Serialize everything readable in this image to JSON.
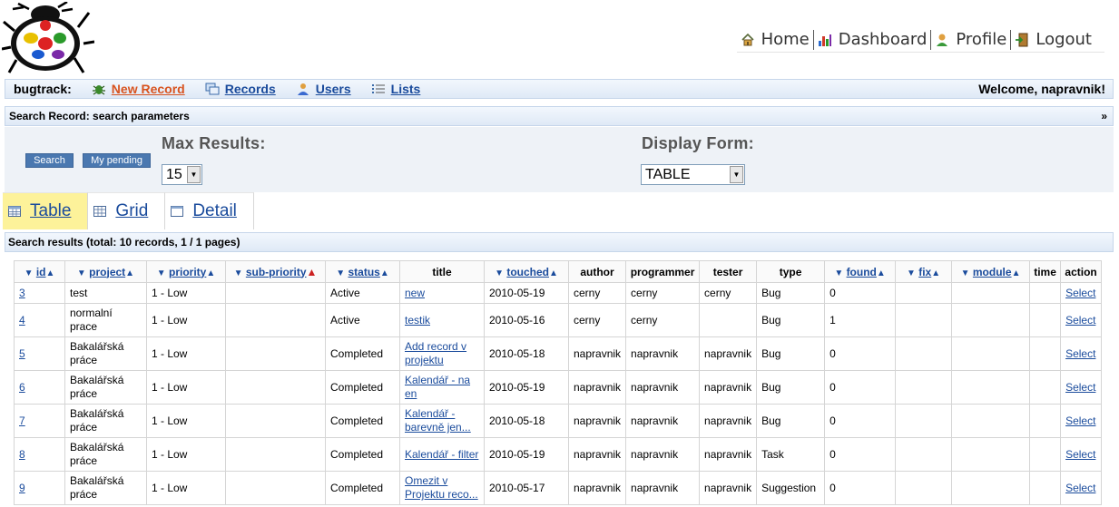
{
  "nav": {
    "home": "Home",
    "dashboard": "Dashboard",
    "profile": "Profile",
    "logout": "Logout"
  },
  "menu": {
    "brand": "bugtrack:",
    "new_record": "New Record",
    "records": "Records",
    "users": "Users",
    "lists": "Lists",
    "welcome": "Welcome, napravnik!"
  },
  "search_panel": {
    "title": "Search Record: search parameters",
    "toggle": "»",
    "search_button": "Search",
    "pending_button": "My pending",
    "max_results_label": "Max Results:",
    "max_results_value": "15",
    "display_form_label": "Display Form:",
    "display_form_value": "TABLE"
  },
  "tabs": {
    "table": "Table",
    "grid": "Grid",
    "detail": "Detail"
  },
  "results": {
    "title": "Search results (total: 10 records, 1 / 1 pages)",
    "columns": [
      "id",
      "project",
      "priority",
      "sub-priority",
      "status",
      "title",
      "touched",
      "author",
      "programmer",
      "tester",
      "type",
      "found",
      "fix",
      "module",
      "time",
      "action"
    ],
    "rows": [
      {
        "id": "3",
        "project": "test",
        "priority": "1 - Low",
        "sub": "",
        "status": "Active",
        "title": "new",
        "touched": "2010-05-19",
        "author": "cerny",
        "programmer": "cerny",
        "tester": "cerny",
        "type": "Bug",
        "found": "0",
        "fix": "",
        "module": "",
        "time": "",
        "action": "Select"
      },
      {
        "id": "4",
        "project": "normalní prace",
        "priority": "1 - Low",
        "sub": "",
        "status": "Active",
        "title": "testik",
        "touched": "2010-05-16",
        "author": "cerny",
        "programmer": "cerny",
        "tester": "",
        "type": "Bug",
        "found": "1",
        "fix": "",
        "module": "",
        "time": "",
        "action": "Select"
      },
      {
        "id": "5",
        "project": "Bakalářská práce",
        "priority": "1 - Low",
        "sub": "",
        "status": "Completed",
        "title": "Add record v projektu",
        "touched": "2010-05-18",
        "author": "napravnik",
        "programmer": "napravnik",
        "tester": "napravnik",
        "type": "Bug",
        "found": "0",
        "fix": "",
        "module": "",
        "time": "",
        "action": "Select"
      },
      {
        "id": "6",
        "project": "Bakalářská práce",
        "priority": "1 - Low",
        "sub": "",
        "status": "Completed",
        "title": "Kalendář - na en",
        "touched": "2010-05-19",
        "author": "napravnik",
        "programmer": "napravnik",
        "tester": "napravnik",
        "type": "Bug",
        "found": "0",
        "fix": "",
        "module": "",
        "time": "",
        "action": "Select"
      },
      {
        "id": "7",
        "project": "Bakalářská práce",
        "priority": "1 - Low",
        "sub": "",
        "status": "Completed",
        "title": "Kalendář - barevně jen...",
        "touched": "2010-05-18",
        "author": "napravnik",
        "programmer": "napravnik",
        "tester": "napravnik",
        "type": "Bug",
        "found": "0",
        "fix": "",
        "module": "",
        "time": "",
        "action": "Select"
      },
      {
        "id": "8",
        "project": "Bakalářská práce",
        "priority": "1 - Low",
        "sub": "",
        "status": "Completed",
        "title": "Kalendář - filter",
        "touched": "2010-05-19",
        "author": "napravnik",
        "programmer": "napravnik",
        "tester": "napravnik",
        "type": "Task",
        "found": "0",
        "fix": "",
        "module": "",
        "time": "",
        "action": "Select"
      },
      {
        "id": "9",
        "project": "Bakalářská práce",
        "priority": "1 - Low",
        "sub": "",
        "status": "Completed",
        "title": "Omezit v Projektu reco...",
        "touched": "2010-05-17",
        "author": "napravnik",
        "programmer": "napravnik",
        "tester": "napravnik",
        "type": "Suggestion",
        "found": "0",
        "fix": "",
        "module": "",
        "time": "",
        "action": "Select"
      }
    ]
  }
}
